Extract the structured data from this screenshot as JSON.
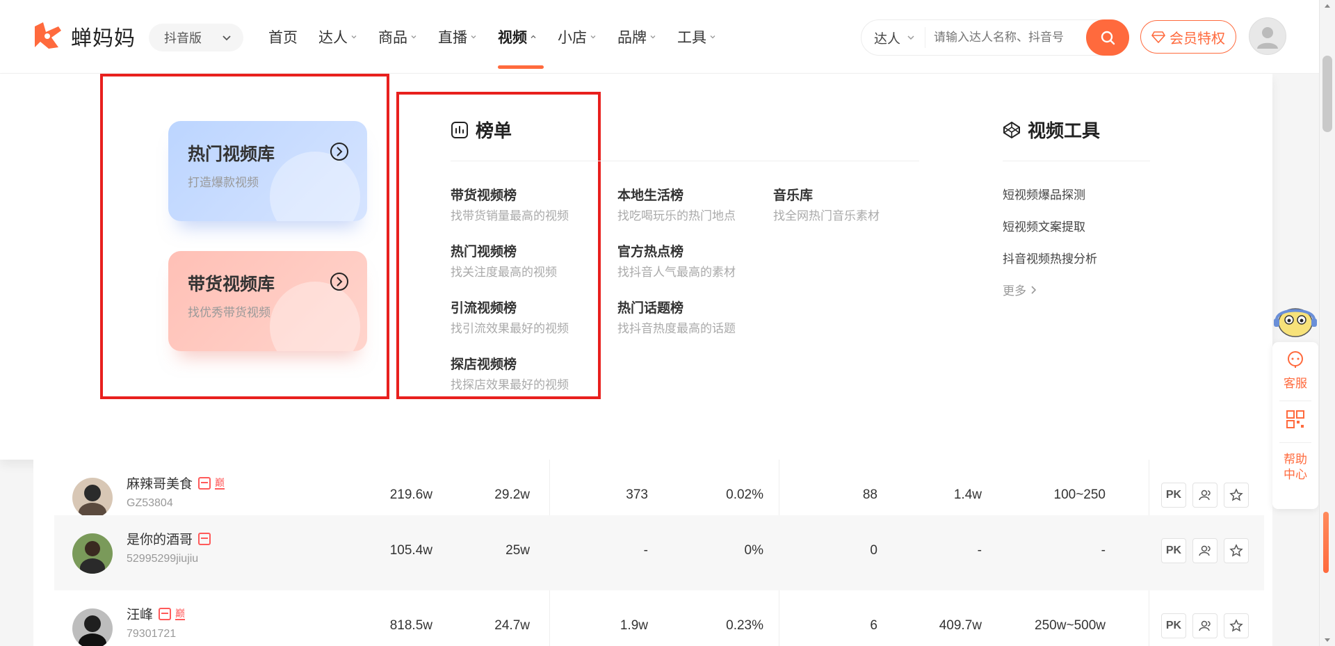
{
  "header": {
    "logo_text": "蝉妈妈",
    "platform": "抖音版",
    "nav": [
      {
        "label": "首页",
        "has_arrow": false
      },
      {
        "label": "达人",
        "has_arrow": true
      },
      {
        "label": "商品",
        "has_arrow": true
      },
      {
        "label": "直播",
        "has_arrow": true
      },
      {
        "label": "视频",
        "has_arrow": true,
        "active": true
      },
      {
        "label": "小店",
        "has_arrow": true
      },
      {
        "label": "品牌",
        "has_arrow": true
      },
      {
        "label": "工具",
        "has_arrow": true
      }
    ],
    "search_type": "达人",
    "search_placeholder": "请输入达人名称、抖音号",
    "vip_label": "会员特权",
    "accent_color": "#ff6a3d"
  },
  "mega_menu": {
    "cards": [
      {
        "title": "热门视频库",
        "subtitle": "打造爆款视频"
      },
      {
        "title": "带货视频库",
        "subtitle": "找优秀带货视频"
      }
    ],
    "ranking_title": "榜单",
    "rankings": [
      {
        "title": "带货视频榜",
        "subtitle": "找带货销量最高的视频"
      },
      {
        "title": "热门视频榜",
        "subtitle": "找关注度最高的视频"
      },
      {
        "title": "引流视频榜",
        "subtitle": "找引流效果最好的视频"
      },
      {
        "title": "探店视频榜",
        "subtitle": "找探店效果最好的视频"
      },
      {
        "title": "本地生活榜",
        "subtitle": "找吃喝玩乐的热门地点"
      },
      {
        "title": "官方热点榜",
        "subtitle": "找抖音人气最高的素材"
      },
      {
        "title": "热门话题榜",
        "subtitle": "找抖音热度最高的话题"
      },
      {
        "title": "音乐库",
        "subtitle": "找全网热门音乐素材"
      }
    ],
    "tools_title": "视频工具",
    "tools": [
      "短视频爆品探测",
      "短视频文案提取",
      "抖音视频热搜分析"
    ],
    "tools_more": "更多"
  },
  "table": {
    "rows": [
      {
        "name": "麻辣哥美食",
        "uid": "GZ53804",
        "shop": true,
        "tag": "巅",
        "c1": "219.6w",
        "c2": "29.2w",
        "c3": "373",
        "c4": "0.02%",
        "c5": "88",
        "c6": "1.4w",
        "c7": "100~250"
      },
      {
        "name": "是你的酒哥",
        "uid": "52995299jiujiu",
        "shop": true,
        "tag": "",
        "c1": "105.4w",
        "c2": "25w",
        "c3": "-",
        "c4": "0%",
        "c5": "0",
        "c6": "-",
        "c7": "-"
      },
      {
        "name": "汪峰",
        "uid": "79301721",
        "shop": true,
        "tag": "巅",
        "c1": "818.5w",
        "c2": "24.7w",
        "c3": "1.9w",
        "c4": "0.23%",
        "c5": "6",
        "c6": "409.7w",
        "c7": "250w~500w"
      }
    ],
    "pk_label": "PK"
  },
  "side": {
    "service_label": "客服",
    "help_label": "帮助中心"
  }
}
